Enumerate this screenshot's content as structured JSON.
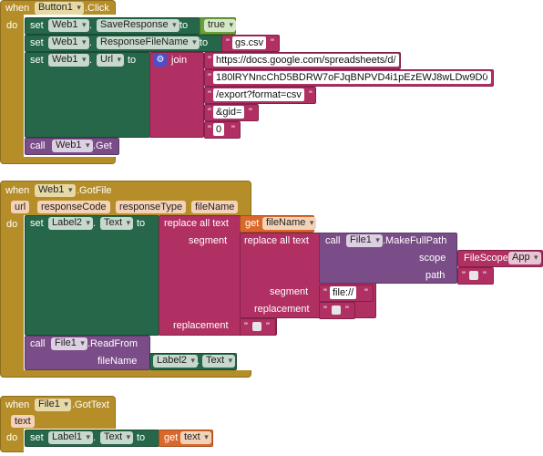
{
  "kw": {
    "when": "when",
    "do": "do",
    "set": "set",
    "to": "to",
    "call": "call",
    "get": "get",
    "join": "join",
    "dot": ".",
    "segment": "segment",
    "replacement": "replacement",
    "replace_all_text": "replace all text",
    "scope": "scope",
    "path": "path",
    "fileName": "fileName",
    "quote": "\""
  },
  "event1": {
    "component": "Button1",
    "event": ".Click",
    "set1": {
      "component": "Web1",
      "property": "SaveResponse",
      "value": "true"
    },
    "set2": {
      "component": "Web1",
      "property": "ResponseFileName",
      "value": "gs.csv"
    },
    "set3": {
      "component": "Web1",
      "property": "Url",
      "parts": [
        "https://docs.google.com/spreadsheets/d/",
        "180lRYNncChD5BDRW7oFJqBNPVD4i1pEzEWJ8wLDw9D0",
        "/export?format=csv",
        "&gid=",
        "0"
      ]
    },
    "call": {
      "component": "Web1",
      "method": ".Get"
    }
  },
  "event2": {
    "component": "Web1",
    "event": ".GotFile",
    "params": [
      "url",
      "responseCode",
      "responseType",
      "fileName"
    ],
    "set": {
      "component": "Label2",
      "property": "Text"
    },
    "get_var": "fileName",
    "makefullpath": {
      "component": "File1",
      "method": ".MakeFullPath",
      "scope_value": "FileScope",
      "scope_option": "App"
    },
    "inner_segment": "file://",
    "call": {
      "component": "File1",
      "method": ".ReadFrom"
    },
    "arg": {
      "component": "Label2",
      "property": "Text"
    }
  },
  "event3": {
    "component": "File1",
    "event": ".GotText",
    "params": [
      "text"
    ],
    "set": {
      "component": "Label1",
      "property": "Text"
    },
    "get_var": "text"
  }
}
